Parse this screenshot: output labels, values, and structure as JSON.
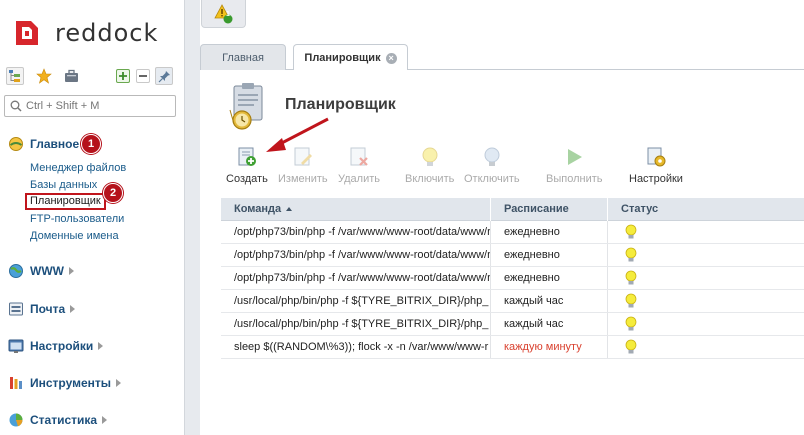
{
  "brand": {
    "name": "reddock",
    "color": "#d7262c"
  },
  "search": {
    "placeholder": "Ctrl + Shift + M"
  },
  "nav": {
    "main": {
      "label": "Главное",
      "badge": "1"
    },
    "sub_items": [
      "Менеджер файлов",
      "Базы данных",
      "Планировщик",
      "FTP-пользователи",
      "Доменные имена"
    ],
    "highlight_badge": "2",
    "sections": [
      "WWW",
      "Почта",
      "Настройки",
      "Инструменты",
      "Статистика"
    ]
  },
  "alerts": {
    "count": "1"
  },
  "tabs": [
    {
      "label": "Главная",
      "active": false
    },
    {
      "label": "Планировщик",
      "active": true
    }
  ],
  "page": {
    "title": "Планировщик"
  },
  "toolbar": {
    "create": "Создать",
    "edit": "Изменить",
    "delete": "Удалить",
    "enable": "Включить",
    "disable": "Отключить",
    "run": "Выполнить",
    "settings": "Настройки"
  },
  "table": {
    "columns": [
      "Команда",
      "Расписание",
      "Статус"
    ],
    "rows": [
      {
        "command": "/opt/php73/bin/php -f /var/www/www-root/data/www/r",
        "schedule": "ежедневно",
        "schedule_color": "#222222"
      },
      {
        "command": "/opt/php73/bin/php -f /var/www/www-root/data/www/r",
        "schedule": "ежедневно",
        "schedule_color": "#222222"
      },
      {
        "command": "/opt/php73/bin/php -f /var/www/www-root/data/www/r",
        "schedule": "ежедневно",
        "schedule_color": "#222222"
      },
      {
        "command": "/usr/local/php/bin/php -f ${TYRE_BITRIX_DIR}/php_",
        "schedule": "каждый час",
        "schedule_color": "#222222"
      },
      {
        "command": "/usr/local/php/bin/php -f ${TYRE_BITRIX_DIR}/php_",
        "schedule": "каждый час",
        "schedule_color": "#222222"
      },
      {
        "command": "sleep $((RANDOM\\%3)); flock -x -n /var/www/www-r",
        "schedule": "каждую минуту",
        "schedule_color": "#d9412f"
      }
    ],
    "status_icon": "lightbulb-on-icon"
  },
  "colors": {
    "accent_red": "#b5121b",
    "header_bg": "#e1e6ec",
    "link": "#1a5b8a"
  }
}
